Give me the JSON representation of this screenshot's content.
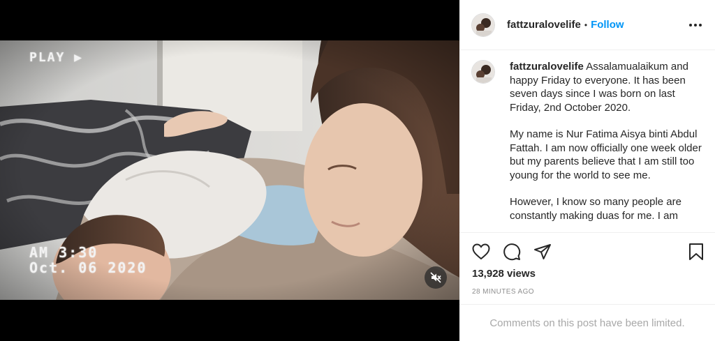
{
  "video": {
    "overlay_play": "PLAY ▶",
    "overlay_time": "AM 3:30",
    "overlay_date": "Oct. 06 2020",
    "mute_icon": "muted-speaker-icon"
  },
  "header": {
    "username": "fattzuralovelife",
    "separator": "•",
    "follow_label": "Follow",
    "more_icon": "more-options-icon"
  },
  "caption": {
    "username": "fattzuralovelife",
    "paragraphs": [
      "Assalamualaikum and happy Friday to everyone. It has been seven days since I was born on last Friday, 2nd October 2020.",
      "My name is Nur Fatima Aisya binti Abdul Fattah. I am now officially one week older but my parents believe that I am still too young for the world to see me.",
      "However, I know so many people are constantly making duas for me. I am"
    ]
  },
  "actions": {
    "like_icon": "heart-icon",
    "comment_icon": "comment-icon",
    "share_icon": "share-icon",
    "save_icon": "bookmark-icon"
  },
  "stats": {
    "views": "13,928 views",
    "time_ago": "28 MINUTES AGO"
  },
  "comments": {
    "limited_text": "Comments on this post have been limited."
  },
  "colors": {
    "accent": "#0095f6",
    "text": "#262626",
    "muted": "#8e8e8e"
  }
}
